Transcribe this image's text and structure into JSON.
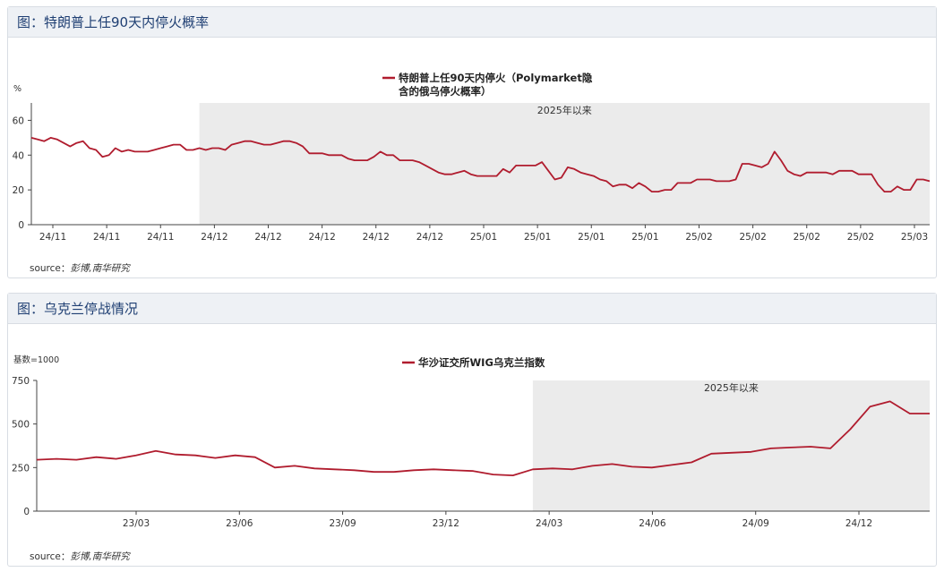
{
  "colors": {
    "line": "#b01c2e",
    "shade": "#ebebeb",
    "axis": "#444444",
    "tick_text": "#333333"
  },
  "panels": [
    {
      "title": "图：特朗普上任90天内停火概率",
      "source_label": "source：",
      "source_text": "彭博,南华研究",
      "chart_data": {
        "type": "line",
        "ylabel": "%",
        "ylim": [
          0,
          70
        ],
        "yticks": [
          0,
          20,
          40,
          60
        ],
        "x_tick_labels": [
          "24/11",
          "24/11",
          "24/11",
          "24/12",
          "24/12",
          "24/12",
          "24/12",
          "24/12",
          "25/01",
          "25/01",
          "25/01",
          "25/01",
          "25/02",
          "25/02",
          "25/02",
          "25/02",
          "25/03"
        ],
        "shaded_region": {
          "label": "2025年以来",
          "from_index": 26
        },
        "series": [
          {
            "name": "特朗普上任90天内停火（Polymarket隐含的俄乌停火概率）",
            "values": [
              50,
              49,
              48,
              50,
              49,
              47,
              45,
              47,
              48,
              44,
              43,
              39,
              40,
              44,
              42,
              43,
              42,
              42,
              42,
              43,
              44,
              45,
              46,
              46,
              43,
              43,
              44,
              43,
              44,
              44,
              43,
              46,
              47,
              48,
              48,
              47,
              46,
              46,
              47,
              48,
              48,
              47,
              45,
              41,
              41,
              41,
              40,
              40,
              40,
              38,
              37,
              37,
              37,
              39,
              42,
              40,
              40,
              37,
              37,
              37,
              36,
              34,
              32,
              30,
              29,
              29,
              30,
              31,
              29,
              28,
              28,
              28,
              28,
              32,
              30,
              34,
              34,
              34,
              34,
              36,
              31,
              26,
              27,
              33,
              32,
              30,
              29,
              28,
              26,
              25,
              22,
              23,
              23,
              21,
              24,
              22,
              19,
              19,
              20,
              20,
              24,
              24,
              24,
              26,
              26,
              26,
              25,
              25,
              25,
              26,
              35,
              35,
              34,
              33,
              35,
              42,
              37,
              31,
              29,
              28,
              30,
              30,
              30,
              30,
              29,
              31,
              31,
              31,
              29,
              29,
              29,
              23,
              19,
              19,
              22,
              20,
              20,
              26,
              26,
              25
            ]
          }
        ]
      }
    },
    {
      "title": "图：乌克兰停战情况",
      "source_label": "source：",
      "source_text": "彭博,南华研究",
      "chart_data": {
        "type": "line",
        "ylabel": "基数=1000",
        "ylim": [
          0,
          750
        ],
        "yticks": [
          0,
          250,
          500,
          750
        ],
        "x_tick_labels": [
          "23/03",
          "23/06",
          "23/09",
          "23/12",
          "24/03",
          "24/06",
          "24/09",
          "24/12"
        ],
        "shaded_region": {
          "label": "2025年以来",
          "from_index": 25
        },
        "series": [
          {
            "name": "华沙证交所WIG乌克兰指数",
            "values": [
              295,
              300,
              295,
              310,
              300,
              320,
              345,
              325,
              320,
              305,
              320,
              310,
              250,
              260,
              245,
              240,
              235,
              225,
              225,
              235,
              240,
              235,
              230,
              210,
              205,
              240,
              245,
              240,
              260,
              270,
              255,
              250,
              265,
              280,
              330,
              335,
              340,
              360,
              365,
              370,
              360,
              470,
              600,
              630,
              560,
              560
            ]
          }
        ]
      }
    }
  ]
}
